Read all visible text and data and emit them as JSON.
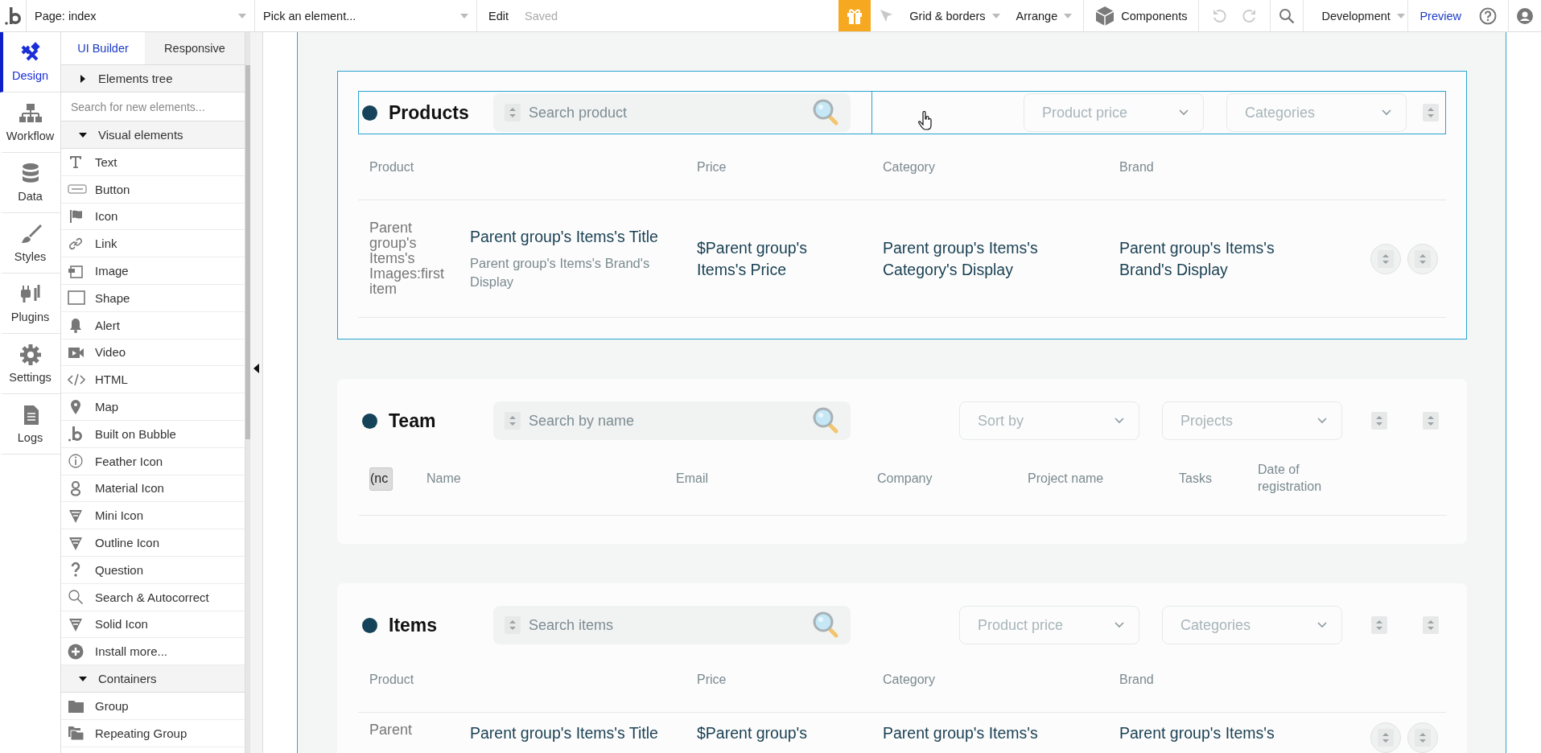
{
  "topbar": {
    "page_select": "Page: index",
    "element_select": "Pick an element...",
    "edit": "Edit",
    "saved": "Saved",
    "grid_menu": "Grid & borders",
    "arrange_menu": "Arrange",
    "components": "Components",
    "mode_select": "Development",
    "preview": "Preview"
  },
  "nav": [
    {
      "label": "Design",
      "selected": true
    },
    {
      "label": "Workflow",
      "selected": false
    },
    {
      "label": "Data",
      "selected": false
    },
    {
      "label": "Styles",
      "selected": false
    },
    {
      "label": "Plugins",
      "selected": false
    },
    {
      "label": "Settings",
      "selected": false
    },
    {
      "label": "Logs",
      "selected": false
    }
  ],
  "panel": {
    "tabs": [
      {
        "label": "UI Builder",
        "selected": true
      },
      {
        "label": "Responsive",
        "selected": false
      }
    ],
    "tree": {
      "label": "Elements tree",
      "expanded": false
    },
    "search": {
      "placeholder": "Search for new elements..."
    },
    "groups": [
      {
        "label": "Visual elements",
        "expanded": true,
        "items": [
          "Text",
          "Button",
          "Icon",
          "Link",
          "Image",
          "Shape",
          "Alert",
          "Video",
          "HTML",
          "Map",
          "Built on Bubble",
          "Feather Icon",
          "Material Icon",
          "Mini Icon",
          "Outline Icon",
          "Question",
          "Search & Autocorrect",
          "Solid Icon",
          "Install more..."
        ]
      },
      {
        "label": "Containers",
        "expanded": true,
        "items": [
          "Group",
          "Repeating Group"
        ]
      }
    ]
  },
  "sections": [
    {
      "kind": "products",
      "title": "Products",
      "selected": true,
      "search": {
        "placeholder": "Search product"
      },
      "filters": [
        "Product price",
        "Categories"
      ],
      "columns": [
        "Product",
        "Price",
        "Category",
        "Brand"
      ],
      "rows": [
        {
          "image": "Parent group's Items's Images:first item",
          "title": "Parent group's Items's Title",
          "subtitle": "Parent group's Items's Brand's Display",
          "price": "$Parent group's Items's Price",
          "category": "Parent group's Items's Category's Display",
          "brand": "Parent group's Items's Brand's Display"
        }
      ]
    },
    {
      "kind": "team",
      "title": "Team",
      "selected": false,
      "search": {
        "placeholder": "Search by name"
      },
      "filters": [
        "Sort by",
        "Projects"
      ],
      "select_all": "(nc",
      "columns": [
        "Name",
        "Email",
        "Company",
        "Project name",
        "Tasks",
        "Date of registration"
      ]
    },
    {
      "kind": "products",
      "title": "Items",
      "selected": false,
      "search": {
        "placeholder": "Search items"
      },
      "filters": [
        "Product price",
        "Categories"
      ],
      "columns": [
        "Product",
        "Price",
        "Category",
        "Brand"
      ],
      "rows": [
        {
          "image": "Parent",
          "title": "Parent group's Items's Title",
          "price": "$Parent group's",
          "category": "Parent group's Items's",
          "brand": "Parent group's Items's"
        }
      ]
    }
  ]
}
